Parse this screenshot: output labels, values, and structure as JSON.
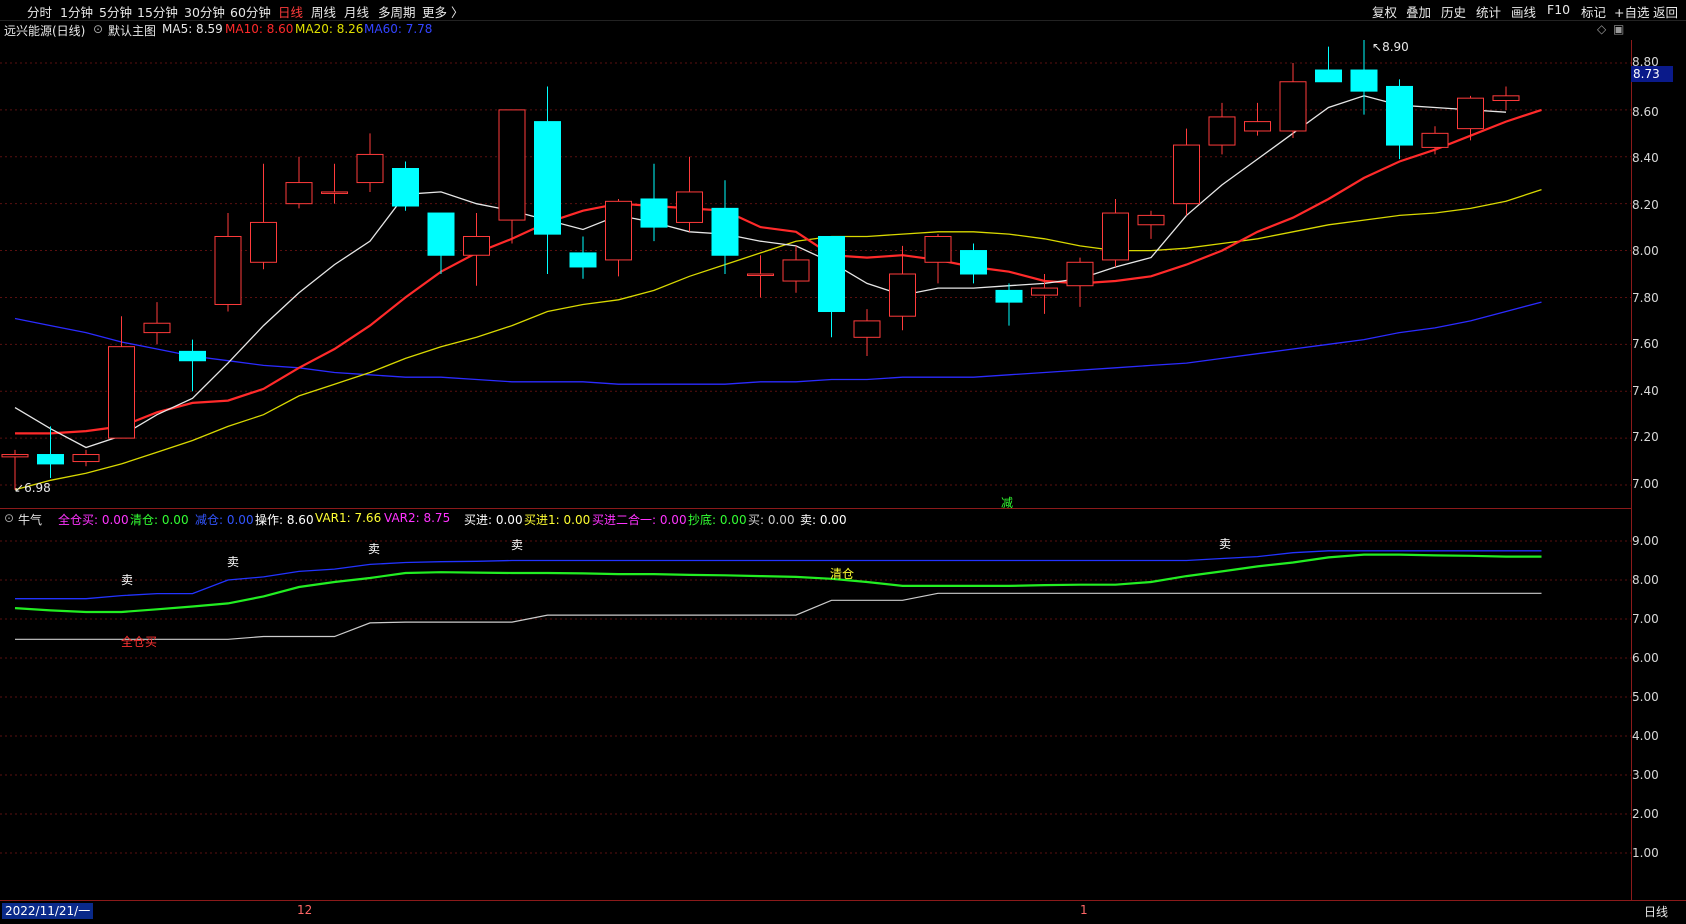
{
  "toolbar": {
    "left": [
      "分时",
      "1分钟",
      "5分钟",
      "15分钟",
      "30分钟",
      "60分钟",
      "日线",
      "周线",
      "月线",
      "多周期",
      "更多 〉"
    ],
    "active": "日线",
    "right": [
      "复权",
      "叠加",
      "历史",
      "统计",
      "画线",
      "F10",
      "标记",
      "+自选",
      "返回"
    ]
  },
  "info": {
    "stock": "远兴能源(日线)",
    "template": "默认主图",
    "ma5": "MA5: 8.59",
    "ma10": "MA10: 8.60",
    "ma20": "MA20: 8.26",
    "ma60": "MA60: 7.78"
  },
  "colors": {
    "up": "#ff3b3b",
    "down": "#00ffff",
    "ma5": "#e6e6e6",
    "ma10": "#ff2a2a",
    "ma20": "#d8d800",
    "ma60": "#2b2bff"
  },
  "price_axis": [
    "8.80",
    "8.60",
    "8.40",
    "8.20",
    "8.00",
    "7.80",
    "7.60",
    "7.40",
    "7.20",
    "7.00"
  ],
  "current_price": "8.73",
  "max_label": "8.90",
  "min_label": "6.98",
  "main_annotation": "减",
  "indicator": {
    "name": "牛气",
    "items": [
      {
        "text": "全仓买: 0.00",
        "color": "#ff33ff"
      },
      {
        "text": "清仓: 0.00",
        "color": "#33ff33"
      },
      {
        "text": "减仓: 0.00",
        "color": "#3355ff"
      },
      {
        "text": "操作: 8.60",
        "color": "#ffffff"
      },
      {
        "text": "VAR1: 7.66",
        "color": "#ffff33"
      },
      {
        "text": "VAR2: 8.75",
        "color": "#ff33ff"
      },
      {
        "text": "买进: 0.00",
        "color": "#ffffff"
      },
      {
        "text": "买进1: 0.00",
        "color": "#ffff33"
      },
      {
        "text": "买进二合一: 0.00",
        "color": "#ff33ff"
      },
      {
        "text": "抄底: 0.00",
        "color": "#33ff33"
      },
      {
        "text": "买: 0.00",
        "color": "#cccccc"
      },
      {
        "text": "卖: 0.00",
        "color": "#ffffff"
      }
    ],
    "axis": [
      "9.00",
      "8.00",
      "7.00",
      "6.00",
      "5.00",
      "4.00",
      "3.00",
      "2.00",
      "1.00"
    ],
    "signals": [
      {
        "text": "卖",
        "color": "#ffffff"
      },
      {
        "text": "卖",
        "color": "#ffffff"
      },
      {
        "text": "卖",
        "color": "#ffffff"
      },
      {
        "text": "卖",
        "color": "#ffffff"
      },
      {
        "text": "卖",
        "color": "#ffffff"
      },
      {
        "text": "全仓买",
        "color": "#ff3333"
      },
      {
        "text": "清仓",
        "color": "#ffff33"
      }
    ]
  },
  "dates": {
    "start": "2022/11/21/一",
    "d12": "12",
    "d1": "1"
  },
  "period_right": "日线",
  "chart_data": {
    "type": "candlestick",
    "ylim": [
      6.93,
      8.95
    ],
    "candles": [
      {
        "o": 7.12,
        "h": 7.15,
        "l": 6.98,
        "c": 7.13
      },
      {
        "o": 7.13,
        "h": 7.25,
        "l": 7.03,
        "c": 7.09
      },
      {
        "o": 7.1,
        "h": 7.15,
        "l": 7.08,
        "c": 7.13
      },
      {
        "o": 7.2,
        "h": 7.72,
        "l": 7.2,
        "c": 7.59
      },
      {
        "o": 7.65,
        "h": 7.78,
        "l": 7.6,
        "c": 7.69
      },
      {
        "o": 7.57,
        "h": 7.62,
        "l": 7.4,
        "c": 7.53
      },
      {
        "o": 7.77,
        "h": 8.16,
        "l": 7.74,
        "c": 8.06
      },
      {
        "o": 7.95,
        "h": 8.37,
        "l": 7.92,
        "c": 8.12
      },
      {
        "o": 8.2,
        "h": 8.4,
        "l": 8.18,
        "c": 8.29
      },
      {
        "o": 8.25,
        "h": 8.37,
        "l": 8.2,
        "c": 8.25
      },
      {
        "o": 8.29,
        "h": 8.5,
        "l": 8.25,
        "c": 8.41
      },
      {
        "o": 8.35,
        "h": 8.38,
        "l": 8.17,
        "c": 8.19
      },
      {
        "o": 8.16,
        "h": 8.16,
        "l": 7.9,
        "c": 7.98
      },
      {
        "o": 7.98,
        "h": 8.16,
        "l": 7.85,
        "c": 8.06
      },
      {
        "o": 8.13,
        "h": 8.6,
        "l": 8.03,
        "c": 8.6
      },
      {
        "o": 8.55,
        "h": 8.7,
        "l": 7.9,
        "c": 8.07
      },
      {
        "o": 7.99,
        "h": 8.06,
        "l": 7.88,
        "c": 7.93
      },
      {
        "o": 7.96,
        "h": 8.22,
        "l": 7.89,
        "c": 8.21
      },
      {
        "o": 8.22,
        "h": 8.37,
        "l": 8.04,
        "c": 8.1
      },
      {
        "o": 8.12,
        "h": 8.4,
        "l": 8.08,
        "c": 8.25
      },
      {
        "o": 8.18,
        "h": 8.3,
        "l": 7.9,
        "c": 7.98
      },
      {
        "o": 7.9,
        "h": 7.98,
        "l": 7.8,
        "c": 7.9
      },
      {
        "o": 7.87,
        "h": 8.02,
        "l": 7.82,
        "c": 7.96
      },
      {
        "o": 8.06,
        "h": 8.06,
        "l": 7.63,
        "c": 7.74
      },
      {
        "o": 7.63,
        "h": 7.75,
        "l": 7.55,
        "c": 7.7
      },
      {
        "o": 7.72,
        "h": 8.02,
        "l": 7.66,
        "c": 7.9
      },
      {
        "o": 7.95,
        "h": 8.07,
        "l": 7.86,
        "c": 8.06
      },
      {
        "o": 8.0,
        "h": 8.03,
        "l": 7.86,
        "c": 7.9
      },
      {
        "o": 7.83,
        "h": 7.86,
        "l": 7.68,
        "c": 7.78
      },
      {
        "o": 7.81,
        "h": 7.9,
        "l": 7.73,
        "c": 7.84
      },
      {
        "o": 7.85,
        "h": 7.97,
        "l": 7.76,
        "c": 7.95
      },
      {
        "o": 7.96,
        "h": 8.22,
        "l": 7.93,
        "c": 8.16
      },
      {
        "o": 8.11,
        "h": 8.17,
        "l": 8.05,
        "c": 8.15
      },
      {
        "o": 8.2,
        "h": 8.52,
        "l": 8.15,
        "c": 8.45
      },
      {
        "o": 8.45,
        "h": 8.63,
        "l": 8.41,
        "c": 8.57
      },
      {
        "o": 8.51,
        "h": 8.63,
        "l": 8.49,
        "c": 8.55
      },
      {
        "o": 8.51,
        "h": 8.8,
        "l": 8.48,
        "c": 8.72
      },
      {
        "o": 8.77,
        "h": 8.87,
        "l": 8.74,
        "c": 8.72
      },
      {
        "o": 8.77,
        "h": 8.9,
        "l": 8.58,
        "c": 8.68
      },
      {
        "o": 8.7,
        "h": 8.73,
        "l": 8.39,
        "c": 8.45
      },
      {
        "o": 8.44,
        "h": 8.53,
        "l": 8.41,
        "c": 8.5
      },
      {
        "o": 8.52,
        "h": 8.66,
        "l": 8.47,
        "c": 8.65
      },
      {
        "o": 8.64,
        "h": 8.7,
        "l": 8.6,
        "c": 8.66
      }
    ],
    "ma5": [
      7.33,
      7.24,
      7.16,
      7.21,
      7.3,
      7.37,
      7.52,
      7.68,
      7.82,
      7.94,
      8.04,
      8.24,
      8.25,
      8.2,
      8.17,
      8.13,
      8.09,
      8.15,
      8.12,
      8.08,
      8.07,
      8.04,
      8.02,
      7.95,
      7.86,
      7.81,
      7.84,
      7.84,
      7.85,
      7.86,
      7.88,
      7.93,
      7.97,
      8.15,
      8.28,
      8.39,
      8.5,
      8.61,
      8.66,
      8.62,
      8.61,
      8.6,
      8.59
    ],
    "ma10": [
      7.22,
      7.22,
      7.23,
      7.25,
      7.31,
      7.35,
      7.36,
      7.41,
      7.5,
      7.58,
      7.68,
      7.8,
      7.91,
      7.99,
      8.05,
      8.12,
      8.17,
      8.2,
      8.19,
      8.18,
      8.17,
      8.1,
      8.08,
      7.98,
      7.97,
      7.98,
      7.96,
      7.93,
      7.91,
      7.87,
      7.86,
      7.87,
      7.89,
      7.94,
      8.0,
      8.08,
      8.14,
      8.22,
      8.31,
      8.38,
      8.43,
      8.49,
      8.55,
      8.6
    ],
    "ma20": [
      6.98,
      7.02,
      7.05,
      7.09,
      7.14,
      7.19,
      7.25,
      7.3,
      7.38,
      7.43,
      7.48,
      7.54,
      7.59,
      7.63,
      7.68,
      7.74,
      7.77,
      7.79,
      7.83,
      7.89,
      7.94,
      7.99,
      8.04,
      8.06,
      8.06,
      8.07,
      8.08,
      8.08,
      8.07,
      8.05,
      8.02,
      8.0,
      8.0,
      8.01,
      8.03,
      8.05,
      8.08,
      8.11,
      8.13,
      8.15,
      8.16,
      8.18,
      8.21,
      8.26
    ],
    "ma60": [
      7.71,
      7.68,
      7.65,
      7.61,
      7.58,
      7.55,
      7.53,
      7.51,
      7.5,
      7.48,
      7.47,
      7.46,
      7.46,
      7.45,
      7.44,
      7.44,
      7.44,
      7.43,
      7.43,
      7.43,
      7.43,
      7.44,
      7.44,
      7.45,
      7.45,
      7.46,
      7.46,
      7.46,
      7.47,
      7.48,
      7.49,
      7.5,
      7.51,
      7.52,
      7.54,
      7.56,
      7.58,
      7.6,
      7.62,
      7.65,
      7.67,
      7.7,
      7.74,
      7.78
    ],
    "ind_ylim": [
      0.5,
      9.65
    ],
    "ind_blue": [
      7.52,
      7.52,
      7.52,
      7.6,
      7.65,
      7.65,
      8.0,
      8.08,
      8.22,
      8.28,
      8.4,
      8.45,
      8.47,
      8.48,
      8.5,
      8.5,
      8.5,
      8.5,
      8.5,
      8.5,
      8.5,
      8.5,
      8.5,
      8.5,
      8.5,
      8.5,
      8.5,
      8.5,
      8.5,
      8.5,
      8.5,
      8.5,
      8.5,
      8.5,
      8.55,
      8.6,
      8.7,
      8.75,
      8.75,
      8.75,
      8.75,
      8.75,
      8.75,
      8.75
    ],
    "ind_green": [
      7.28,
      7.22,
      7.18,
      7.18,
      7.25,
      7.32,
      7.4,
      7.58,
      7.82,
      7.95,
      8.05,
      8.18,
      8.2,
      8.19,
      8.18,
      8.18,
      8.17,
      8.15,
      8.15,
      8.13,
      8.12,
      8.1,
      8.08,
      8.03,
      7.95,
      7.85,
      7.85,
      7.85,
      7.85,
      7.87,
      7.88,
      7.88,
      7.95,
      8.1,
      8.22,
      8.35,
      8.45,
      8.58,
      8.65,
      8.65,
      8.63,
      8.62,
      8.6,
      8.6
    ],
    "ind_white": [
      6.48,
      6.48,
      6.48,
      6.48,
      6.48,
      6.48,
      6.48,
      6.55,
      6.55,
      6.55,
      6.9,
      6.92,
      6.92,
      6.92,
      6.92,
      7.1,
      7.1,
      7.1,
      7.1,
      7.1,
      7.1,
      7.1,
      7.1,
      7.48,
      7.48,
      7.48,
      7.66,
      7.66,
      7.66,
      7.66,
      7.66,
      7.66,
      7.66,
      7.66,
      7.66,
      7.66,
      7.66,
      7.66,
      7.66,
      7.66,
      7.66,
      7.66,
      7.66,
      7.66
    ]
  }
}
